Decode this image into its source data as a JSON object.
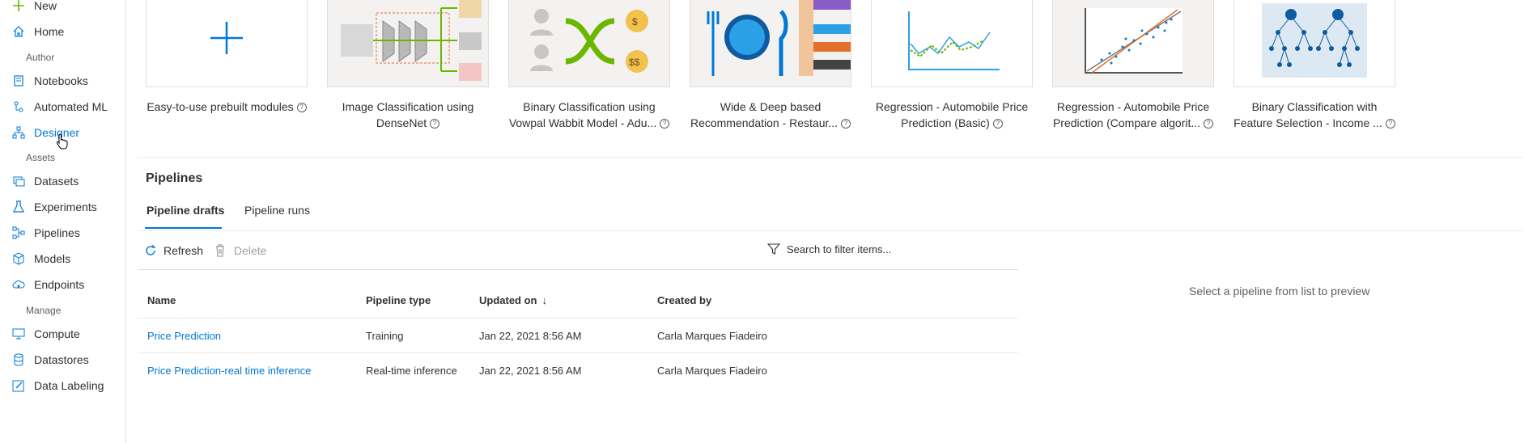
{
  "sidebar": {
    "new_label": "New",
    "home_label": "Home",
    "author_section": "Author",
    "notebooks_label": "Notebooks",
    "automl_label": "Automated ML",
    "designer_label": "Designer",
    "assets_section": "Assets",
    "datasets_label": "Datasets",
    "experiments_label": "Experiments",
    "pipelines_label": "Pipelines",
    "models_label": "Models",
    "endpoints_label": "Endpoints",
    "manage_section": "Manage",
    "compute_label": "Compute",
    "datastores_label": "Datastores",
    "datalabeling_label": "Data Labeling"
  },
  "samples": [
    {
      "line1": "Easy-to-use prebuilt modules",
      "line2": ""
    },
    {
      "line1": "Image Classification using",
      "line2": "DenseNet"
    },
    {
      "line1": "Binary Classification using",
      "line2": "Vowpal Wabbit Model - Adu..."
    },
    {
      "line1": "Wide & Deep based",
      "line2": "Recommendation - Restaur..."
    },
    {
      "line1": "Regression - Automobile Price",
      "line2": "Prediction (Basic)"
    },
    {
      "line1": "Regression - Automobile Price",
      "line2": "Prediction (Compare algorit..."
    },
    {
      "line1": "Binary Classification with",
      "line2": "Feature Selection - Income ..."
    }
  ],
  "pipelines": {
    "title": "Pipelines",
    "tab_drafts": "Pipeline drafts",
    "tab_runs": "Pipeline runs",
    "refresh_label": "Refresh",
    "delete_label": "Delete",
    "search_placeholder": "Search to filter items...",
    "columns": {
      "name": "Name",
      "type": "Pipeline type",
      "updated": "Updated on",
      "created": "Created by"
    },
    "rows": [
      {
        "name": "Price Prediction",
        "type": "Training",
        "updated": "Jan 22, 2021 8:56 AM",
        "created": "Carla Marques Fiadeiro"
      },
      {
        "name": "Price Prediction-real time inference",
        "type": "Real-time inference",
        "updated": "Jan 22, 2021 8:56 AM",
        "created": "Carla Marques Fiadeiro"
      }
    ],
    "preview_text": "Select a pipeline from list to preview"
  },
  "colors": {
    "accent": "#0078d4",
    "green": "#6bb700",
    "orange": "#e3712d"
  }
}
